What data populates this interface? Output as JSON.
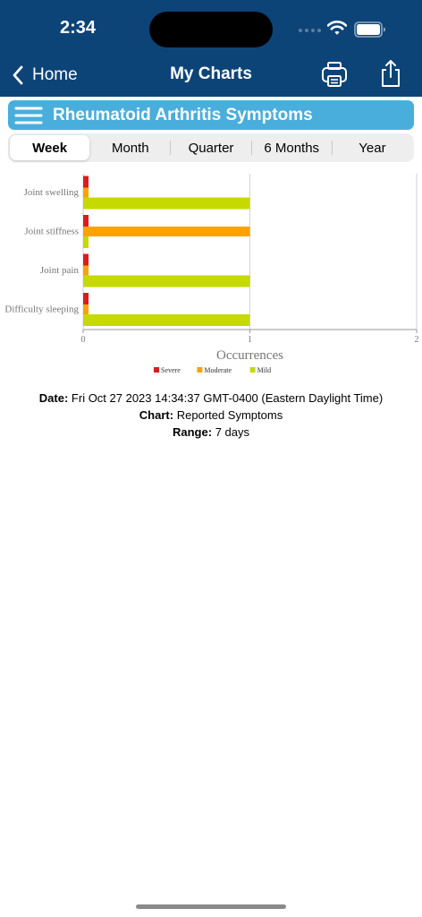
{
  "status_bar": {
    "time": "2:34"
  },
  "nav": {
    "back_label": "Home",
    "title": "My Charts"
  },
  "header": {
    "title": "Rheumatoid Arthritis Symptoms"
  },
  "tabs": [
    {
      "label": "Week",
      "selected": true
    },
    {
      "label": "Month",
      "selected": false
    },
    {
      "label": "Quarter",
      "selected": false
    },
    {
      "label": "6 Months",
      "selected": false
    },
    {
      "label": "Year",
      "selected": false
    }
  ],
  "chart_data": {
    "type": "bar",
    "orientation": "horizontal",
    "categories": [
      "Joint swelling",
      "Joint stiffness",
      "Joint pain",
      "Difficulty sleeping"
    ],
    "series": [
      {
        "name": "Severe",
        "color": "#e01b1b",
        "values": [
          0,
          0,
          0,
          0
        ]
      },
      {
        "name": "Moderate",
        "color": "#ffa200",
        "values": [
          0,
          1,
          0,
          0
        ]
      },
      {
        "name": "Mild",
        "color": "#c6d900",
        "values": [
          1,
          0,
          1,
          1
        ]
      }
    ],
    "xlabel": "Occurrences",
    "xlim": [
      0,
      2
    ],
    "xticks": [
      "0",
      "1",
      "2"
    ],
    "grid": true,
    "legend_position": "bottom"
  },
  "info": {
    "date_label": "Date:",
    "date_value": "Fri Oct 27 2023 14:34:37 GMT-0400 (Eastern Daylight Time)",
    "chart_label": "Chart:",
    "chart_value": "Reported Symptoms",
    "range_label": "Range:",
    "range_value": "7 days"
  }
}
